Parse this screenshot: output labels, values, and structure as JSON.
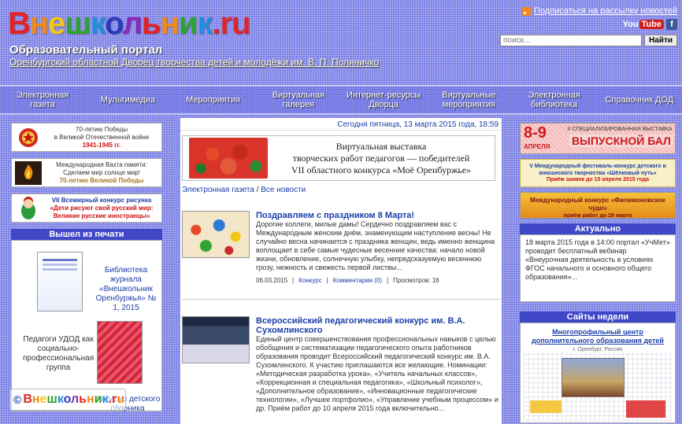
{
  "header": {
    "logo_letters": [
      {
        "ch": "В",
        "color": "#e52222"
      },
      {
        "ch": "н",
        "color": "#f28b13"
      },
      {
        "ch": "е",
        "color": "#f2c812"
      },
      {
        "ch": "ш",
        "color": "#2ea42e"
      },
      {
        "ch": "к",
        "color": "#1f8ed8"
      },
      {
        "ch": "о",
        "color": "#2a3ab8"
      },
      {
        "ch": "л",
        "color": "#8a2ab8"
      },
      {
        "ch": "ь",
        "color": "#e52222"
      },
      {
        "ch": "н",
        "color": "#f28b13"
      },
      {
        "ch": "и",
        "color": "#2ea42e"
      },
      {
        "ch": "к",
        "color": "#1f8ed8"
      },
      {
        "ch": ".ru",
        "color": "#d8282e"
      }
    ],
    "portal_title": "Образовательный портал",
    "portal_subtitle": "Оренбургский областной Дворец творчества детей и молодёжи им. В. П. Поляничко",
    "rss_label": "Подписаться на рассылку новостей",
    "youtube_label": "You",
    "youtube_tube": "Tube",
    "facebook_label": "f",
    "search_placeholder": "поиск...",
    "search_button": "Найти"
  },
  "nav": [
    "Электронная газета",
    "Мультимедиа",
    "Мероприятия",
    "Виртуальная галерея",
    "Интернет-ресурсы Дворца",
    "Виртуальные мероприятия",
    "Электронная библиотека",
    "Справочник ДОД"
  ],
  "left": {
    "banner1_line1": "70-летию Победы",
    "banner1_line2": "в Великой Отечественной войне",
    "banner1_years": "1941-1945 гг.",
    "banner2_line1": "Международная Вахта памяти:",
    "banner2_line2": "Сделаем мир солнце мир!",
    "banner2_line3": "70-летию Великой Победы",
    "banner3_line1": "VII Всемирный конкурс рисунка",
    "banner3_line2": "«Дети рисуют свой русский мир:",
    "banner3_line3": "Великие русские иностранцы»",
    "print_title": "Вышел из печати",
    "print_item1": "Библиотека журнала «Внешкольник Оренбуржья» № 1, 2015",
    "print_item2": "Педагоги УДОД как социально-профессиональная группа",
    "print_item3": "Фокус из детского сборника"
  },
  "center": {
    "date_line": "Сегодня пятница, 13 марта 2015 года, 18:59",
    "banner_line1": "Виртуальная выставка",
    "banner_line2": "творческих работ педагогов — победителей",
    "banner_line3": "VII областного конкурса «Моё Оренбуржье»",
    "crumb_link": "Электронная газета",
    "crumb_sep": " / ",
    "crumb_rest": "Все новости",
    "news": [
      {
        "title": "Поздравляем с праздником 8 Марта!",
        "text": "Дорогие коллеги, милые дамы! Сердечно поздравляем вас с Международным женским днём, знаменующим наступление весны! Не случайно весна начинается с праздника женщин, ведь именно женщина воплощает в себе самые чудесные весенние качества: начало новой жизни, обновление, солнечную улыбку, непредсказуемую весеннюю грозу, нежность и свежесть первой листвы...",
        "date": "06.03.2015",
        "category": "Конкурс",
        "comments": "Комментарии (0)",
        "views": "Просмотров: 16"
      },
      {
        "title": "Всероссийский педагогический конкурс им. В.А. Сухомлинского",
        "text": "Единый центр совершенствования профессиональных навыков с целью обобщения и систематизации педагогического опыта работников образования проводит Всероссийский педагогический конкурс им. В.А. Сухомлинского. К участию приглашаются все желающие. Номинации: «Методическая разработка урока», «Учитель начальных классов», «Коррекционная и специальная педагогика», «Школьный психолог», «Дополнительное образование», «Инновационные педагогические технологии», «Лучшее портфолио», «Управление учебным процессом» и др. Приём работ до 10 апреля 2015 года включительно..."
      }
    ]
  },
  "right": {
    "banner1_dates": "8-9",
    "banner1_month": "АПРЕЛЯ",
    "banner1_text": "II СПЕЦИАЛИЗИРОВАННАЯ ВЫСТАВКА",
    "banner1_title": "ВЫПУСКНОЙ БАЛ",
    "banner2_text": "V Международный фестиваль-конкурс детского и юношеского творчества «Шёлковый путь»",
    "banner2_sub": "Приём заявок до 15 апреля 2015 года",
    "banner3_text": "Международный конкурс «Филимоновское чудо»",
    "banner3_sub": "приём работ до 29 марта",
    "actual_title": "Актуально",
    "actual_text": "18 марта 2015 года в 14:00 портал «УчМет» проводит бесплатный вебинар «Внеурочная деятельность в условиях ФГОС начального и основного общего образования»...",
    "partner_title": "Сайты недели",
    "partner_name": "Многопрофильный центр дополнительного образования детей",
    "partner_city": "г. Оренбург, Россия"
  },
  "footer": {
    "copyright_symbol": "©",
    "logo_text": "Внешкольник.ru"
  }
}
